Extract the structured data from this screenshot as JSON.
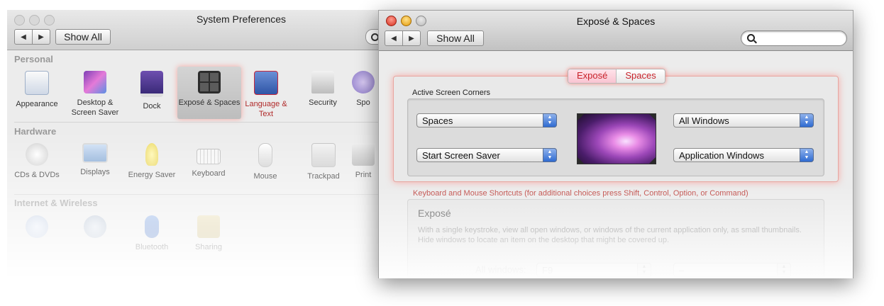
{
  "back_window": {
    "title": "System Preferences",
    "show_all_label": "Show All",
    "sections": {
      "personal": "Personal",
      "hardware": "Hardware",
      "internet": "Internet & Wireless"
    },
    "personal_items": [
      {
        "label": "Appearance",
        "icon": "appearance-icon"
      },
      {
        "label": "Desktop & Screen Saver",
        "icon": "desktop-icon"
      },
      {
        "label": "Dock",
        "icon": "dock-icon"
      },
      {
        "label": "Exposé & Spaces",
        "icon": "expose-spaces-icon"
      },
      {
        "label": "Language & Text",
        "icon": "language-flag-icon"
      },
      {
        "label": "Security",
        "icon": "security-house-icon"
      },
      {
        "label": "Spo",
        "icon": "spotlight-icon"
      }
    ],
    "hardware_items": [
      {
        "label": "CDs & DVDs",
        "icon": "cd-icon"
      },
      {
        "label": "Displays",
        "icon": "display-icon"
      },
      {
        "label": "Energy Saver",
        "icon": "bulb-icon"
      },
      {
        "label": "Keyboard",
        "icon": "keyboard-icon"
      },
      {
        "label": "Mouse",
        "icon": "mouse-icon"
      },
      {
        "label": "Trackpad",
        "icon": "trackpad-icon"
      },
      {
        "label": "Print",
        "icon": "printer-icon"
      }
    ],
    "internet_items": [
      {
        "label": "",
        "icon": "mobileme-icon"
      },
      {
        "label": "",
        "icon": "network-icon"
      },
      {
        "label": "Bluetooth",
        "icon": "bluetooth-icon"
      },
      {
        "label": "Sharing",
        "icon": "sharing-icon"
      }
    ]
  },
  "front_window": {
    "title": "Exposé & Spaces",
    "show_all_label": "Show All",
    "search_placeholder": "",
    "tabs": [
      {
        "label": "Exposé",
        "active": true
      },
      {
        "label": "Spaces",
        "active": false
      }
    ],
    "corners": {
      "group_label": "Active Screen Corners",
      "top_left": "Spaces",
      "bottom_left": "Start Screen Saver",
      "top_right": "All Windows",
      "bottom_right": "Application Windows"
    },
    "shortcuts": {
      "label": "Keyboard and Mouse Shortcuts (for additional choices press Shift, Control, Option, or Command)",
      "expose_heading": "Exposé",
      "expose_description": "With a single keystroke, view all open windows, or windows of the current application only, as small thumbnails. Hide windows to locate an item on the desktop that might be covered up.",
      "all_windows_label": "All windows:",
      "all_windows_key": "F9",
      "all_windows_mouse": "–"
    }
  },
  "colors": {
    "accent_red": "#c8222a",
    "glow": "#ff6e64",
    "popup_blue": "#2f6bd1"
  }
}
